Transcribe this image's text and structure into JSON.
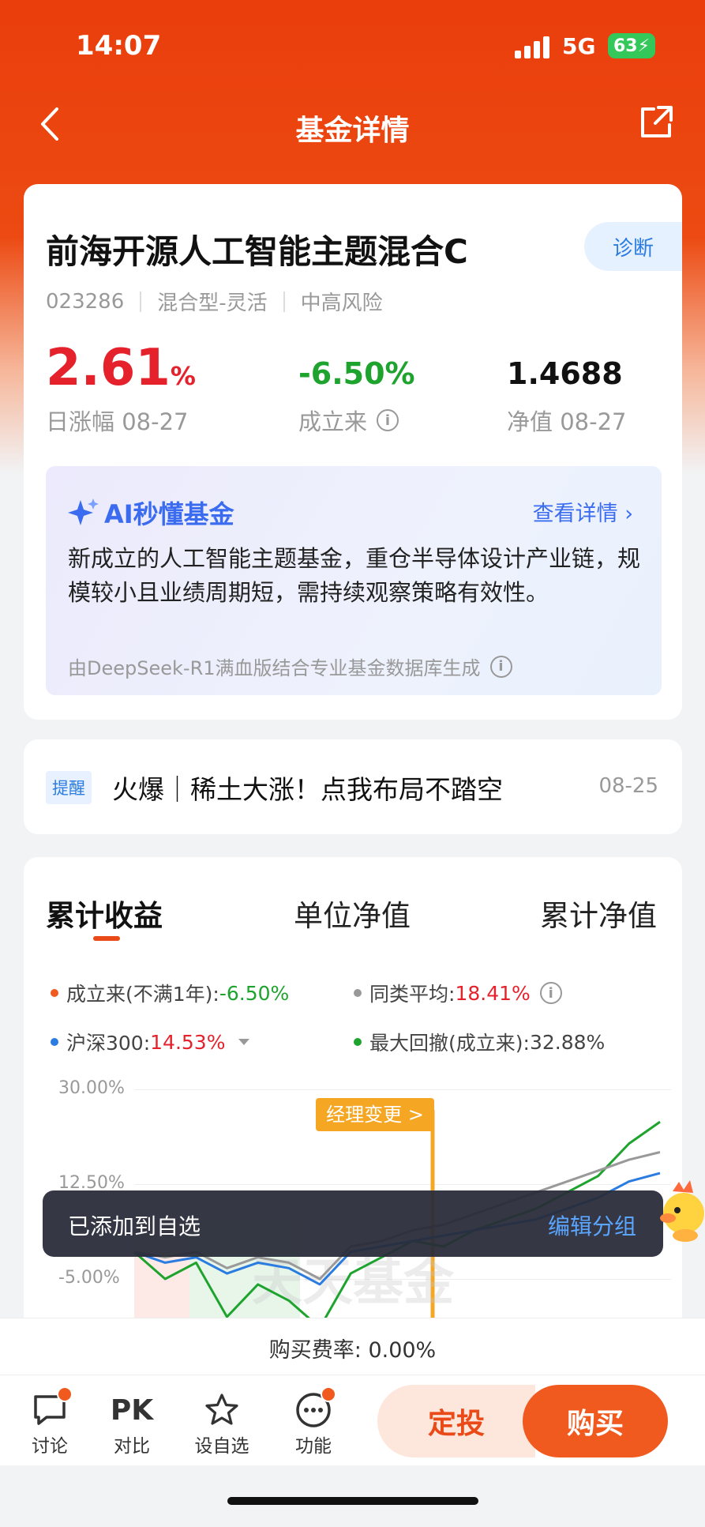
{
  "status_bar": {
    "time": "14:07",
    "network": "5G",
    "battery": "63"
  },
  "nav": {
    "title": "基金详情"
  },
  "fund": {
    "name": "前海开源人工智能主题混合C",
    "diagnose_label": "诊断",
    "code": "023286",
    "type": "混合型-灵活",
    "risk": "中高风险",
    "daily_change": "2.61",
    "daily_change_unit": "%",
    "daily_change_label": "日涨幅 08-27",
    "since_inception": "-6.50%",
    "since_inception_label": "成立来",
    "nav_value": "1.4688",
    "nav_label": "净值 08-27"
  },
  "ai_summary": {
    "title": "AI秒懂基金",
    "more_label": "查看详情 ›",
    "text": "新成立的人工智能主题基金，重仓半导体设计产业链，规模较小且业绩周期短，需持续观察策略有效性。",
    "source": "由DeepSeek-R1满血版结合专业基金数据库生成"
  },
  "notice": {
    "tag": "提醒",
    "text": "火爆｜稀土大涨！点我布局不踏空",
    "date": "08-25"
  },
  "chart_tabs": [
    "累计收益",
    "单位净值",
    "累计净值"
  ],
  "legend": {
    "inception_label": "成立来(不满1年):",
    "inception_value": "-6.50%",
    "peer_label": "同类平均:",
    "peer_value": "18.41%",
    "hs300_label": "沪深300:",
    "hs300_value": "14.53%",
    "drawdown_label": "最大回撤(成立来):",
    "drawdown_value": "32.88%"
  },
  "chart_data": {
    "type": "line",
    "ylabels": [
      "30.00%",
      "12.50%",
      "-5.00%"
    ],
    "annotation": "经理变更 >",
    "watermark": "天天基金",
    "series": [
      {
        "name": "成立来(不满1年)",
        "color": "#1ea32e",
        "values": [
          0,
          -5,
          -2,
          -12,
          -6,
          -9,
          -14,
          -4,
          -1,
          2,
          1,
          4,
          6,
          8,
          11,
          14,
          20,
          24
        ]
      },
      {
        "name": "沪深300",
        "color": "#2b7ce0",
        "values": [
          0,
          -2,
          -1,
          -4,
          -2,
          -3,
          -6,
          0,
          1,
          2,
          3,
          4,
          5,
          6,
          8,
          10,
          13,
          14.53
        ]
      },
      {
        "name": "同类平均",
        "color": "#999999",
        "values": [
          0,
          -1,
          0,
          -3,
          -1,
          -2,
          -5,
          1,
          2,
          4,
          5,
          7,
          9,
          11,
          13,
          15,
          17,
          18.41
        ]
      }
    ]
  },
  "toast": {
    "message": "已添加到自选",
    "action": "编辑分组"
  },
  "fee": {
    "label": "购买费率: 0.00%"
  },
  "bottom_bar": {
    "discuss": "讨论",
    "compare_icon": "PK",
    "compare": "对比",
    "watchlist": "设自选",
    "more": "功能",
    "sip": "定投",
    "buy": "购买"
  },
  "colors": {
    "brand": "#ea3e0c",
    "up": "#e5222c",
    "down": "#1ea32e",
    "link": "#2b7ce0"
  }
}
